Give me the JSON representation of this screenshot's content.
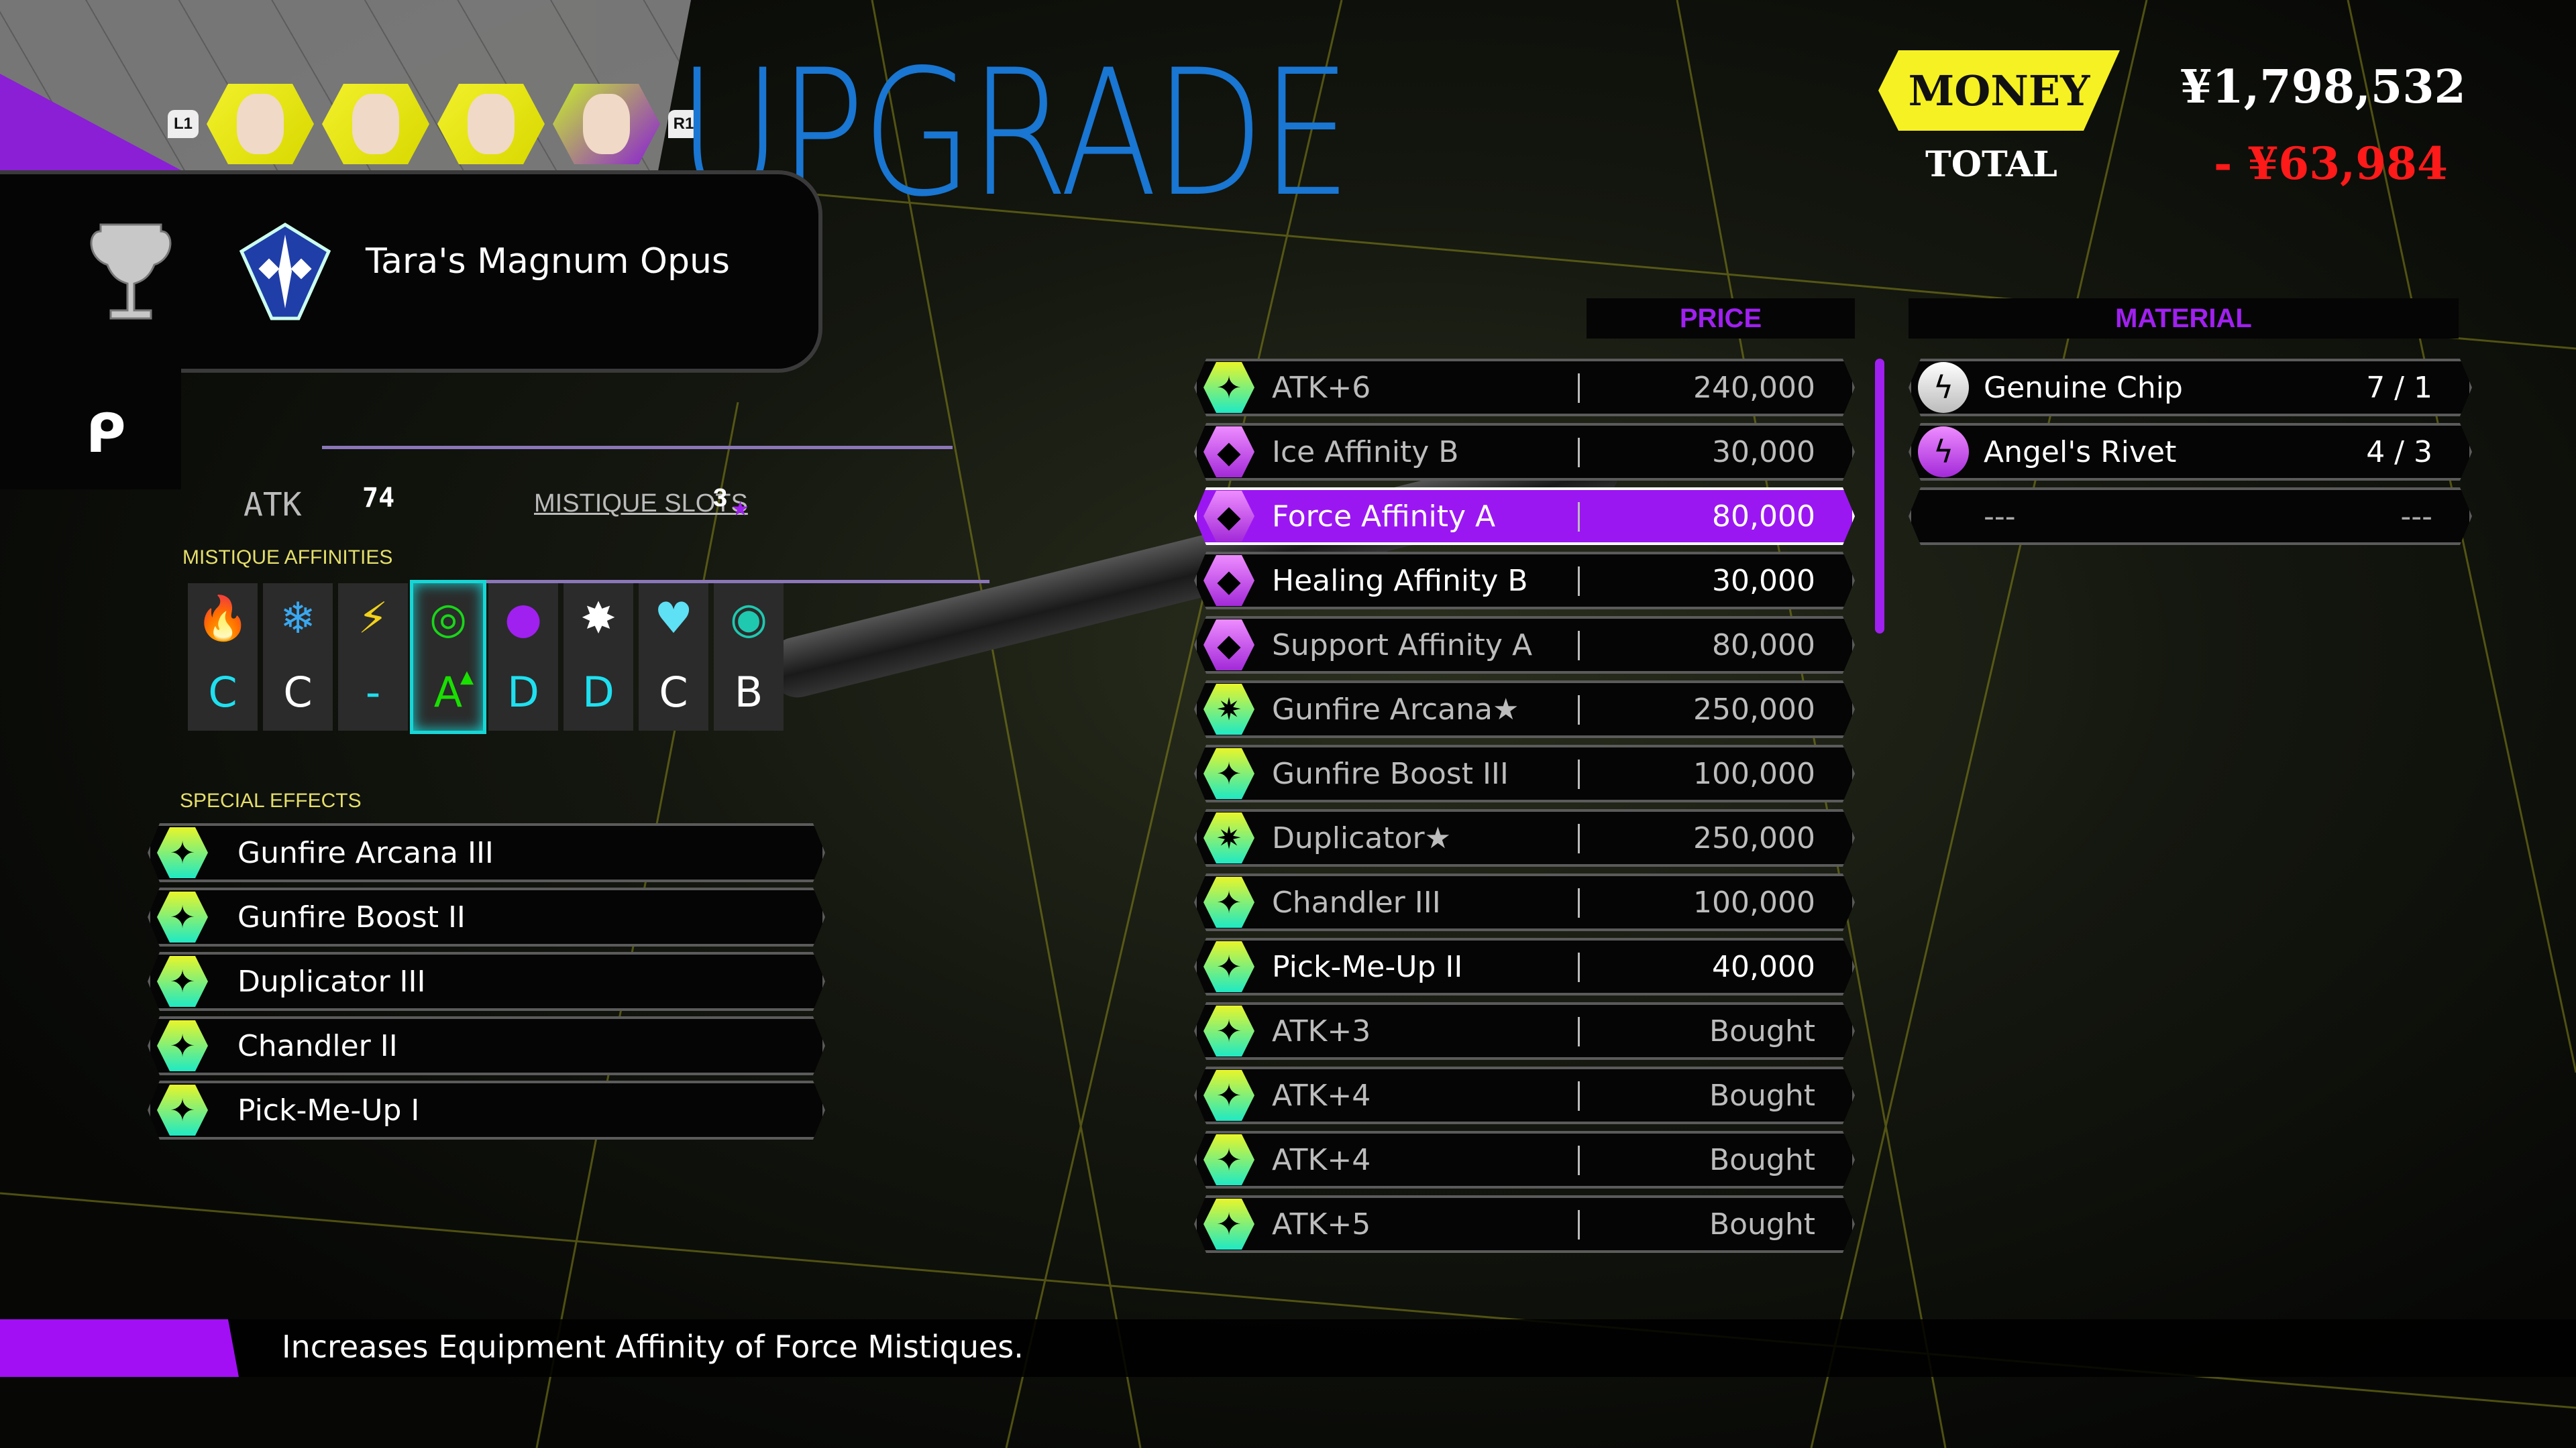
{
  "header": {
    "title": "UPGRADE",
    "party_prev_button": "L1",
    "party_next_button": "R1",
    "party": [
      {
        "name": "party-member-1",
        "active": false
      },
      {
        "name": "party-member-2",
        "active": false
      },
      {
        "name": "party-member-3",
        "active": false
      },
      {
        "name": "party-member-4",
        "active": true
      }
    ]
  },
  "trophy": {
    "name": "Tara's Magnum Opus",
    "icon": "silver-trophy-icon"
  },
  "stats": {
    "atk_label": "ATK",
    "atk_value": "74",
    "slots_label": "MISTIQUE SLOTS",
    "slots_value": "3",
    "affinities_label": "MISTIQUE AFFINITIES",
    "affinities": [
      {
        "element": "fire",
        "icon": "🔥",
        "grade": "C",
        "color": "#1ee0f0",
        "icon_color": "#f02020"
      },
      {
        "element": "ice",
        "icon": "❄",
        "grade": "C",
        "color": "#ffffff",
        "icon_color": "#3aa8f0"
      },
      {
        "element": "elec",
        "icon": "⚡",
        "grade": "-",
        "color": "#1ee0f0",
        "icon_color": "#f2d21a"
      },
      {
        "element": "force",
        "icon": "◎",
        "grade": "A",
        "color": "#19e000",
        "icon_color": "#19d619",
        "selected": true,
        "up": "▲"
      },
      {
        "element": "ruin",
        "icon": "●",
        "grade": "D",
        "color": "#1ee0f0",
        "icon_color": "#a020f0"
      },
      {
        "element": "almighty",
        "icon": "✸",
        "grade": "D",
        "color": "#1ee0f0",
        "icon_color": "#ffffff"
      },
      {
        "element": "healing",
        "icon": "♥",
        "grade": "C",
        "color": "#ffffff",
        "icon_color": "#5ee0f5"
      },
      {
        "element": "support",
        "icon": "◉",
        "grade": "B",
        "color": "#ffffff",
        "icon_color": "#1ec9b0"
      }
    ],
    "special_effects_label": "SPECIAL EFFECTS",
    "special_effects": [
      "Gunfire Arcana III",
      "Gunfire Boost II",
      "Duplicator III",
      "Chandler II",
      "Pick-Me-Up I"
    ]
  },
  "price_header": "PRICE",
  "material_header": "MATERIAL",
  "upgrades": [
    {
      "name": "ATK+6",
      "price": "240,000",
      "type": "green",
      "state": "dim"
    },
    {
      "name": "Ice Affinity B",
      "price": "30,000",
      "type": "purple",
      "state": "dim"
    },
    {
      "name": "Force Affinity A",
      "price": "80,000",
      "type": "purple",
      "state": "selected"
    },
    {
      "name": "Healing Affinity B",
      "price": "30,000",
      "type": "purple",
      "state": "normal"
    },
    {
      "name": "Support Affinity A",
      "price": "80,000",
      "type": "purple",
      "state": "dim"
    },
    {
      "name": "Gunfire Arcana★",
      "price": "250,000",
      "type": "green-star",
      "state": "dim"
    },
    {
      "name": "Gunfire Boost III",
      "price": "100,000",
      "type": "green",
      "state": "dim"
    },
    {
      "name": "Duplicator★",
      "price": "250,000",
      "type": "green-star",
      "state": "dim"
    },
    {
      "name": "Chandler III",
      "price": "100,000",
      "type": "green",
      "state": "dim"
    },
    {
      "name": "Pick-Me-Up II",
      "price": "40,000",
      "type": "green",
      "state": "normal"
    },
    {
      "name": "ATK+3",
      "price": "Bought",
      "type": "green",
      "state": "dim"
    },
    {
      "name": "ATK+4",
      "price": "Bought",
      "type": "green",
      "state": "dim"
    },
    {
      "name": "ATK+4",
      "price": "Bought",
      "type": "green",
      "state": "dim"
    },
    {
      "name": "ATK+5",
      "price": "Bought",
      "type": "green",
      "state": "dim"
    }
  ],
  "materials": [
    {
      "name": "Genuine Chip",
      "qty": "7 /   1",
      "icon": "white"
    },
    {
      "name": "Angel's Rivet",
      "qty": "4 /   3",
      "icon": "purple"
    },
    {
      "name": "---",
      "qty": "---",
      "icon": "none"
    }
  ],
  "money": {
    "label": "MONEY",
    "value": "¥1,798,532",
    "total_label": "TOTAL",
    "total_value": "- ¥63,984"
  },
  "description": "Increases Equipment Affinity of Force Mistiques.",
  "colors": {
    "accent_purple": "#a20ff5",
    "title_blue": "#1976d2",
    "money_yellow": "#f6f122",
    "cost_red": "#ff1a1a"
  }
}
